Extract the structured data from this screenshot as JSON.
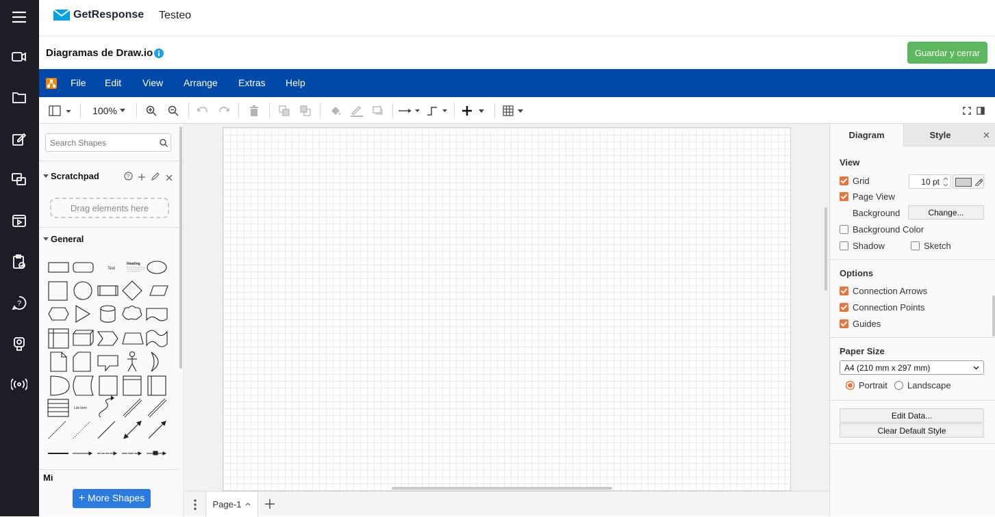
{
  "topbar": {
    "brand": "GetResponse",
    "account": "Testeo"
  },
  "titlebar": {
    "title": "Diagramas de Draw.io",
    "save_label": "Guardar y cerrar"
  },
  "menu": {
    "items": [
      "File",
      "Edit",
      "View",
      "Arrange",
      "Extras",
      "Help"
    ]
  },
  "toolbar": {
    "zoom": "100%"
  },
  "sidebar": {
    "search_placeholder": "Search Shapes",
    "scratchpad_title": "Scratchpad",
    "drag_hint": "Drag elements here",
    "general_title": "General",
    "more_shapes_label": "More Shapes",
    "text_shape_label": "Text",
    "heading_shape_label": "Heading",
    "list_shape_label": "List",
    "list_item_label": "List Item",
    "misc_partial": "Mi"
  },
  "bottom": {
    "page_tab": "Page-1"
  },
  "panel": {
    "tab_diagram": "Diagram",
    "tab_style": "Style",
    "view_title": "View",
    "grid_label": "Grid",
    "grid_size": "10 pt",
    "page_view_label": "Page View",
    "background_label": "Background",
    "change_label": "Change...",
    "bg_color_label": "Background Color",
    "shadow_label": "Shadow",
    "sketch_label": "Sketch",
    "options_title": "Options",
    "conn_arrows_label": "Connection Arrows",
    "conn_points_label": "Connection Points",
    "guides_label": "Guides",
    "paper_title": "Paper Size",
    "paper_value": "A4 (210 mm x 297 mm)",
    "portrait_label": "Portrait",
    "landscape_label": "Landscape",
    "edit_data_label": "Edit Data...",
    "clear_style_label": "Clear Default Style"
  },
  "colors": {
    "menubar": "#0049a9",
    "save": "#5cb85c",
    "checkbox": "#e8733b",
    "more_shapes": "#2b7bde",
    "leftbar": "#1c1d25"
  }
}
